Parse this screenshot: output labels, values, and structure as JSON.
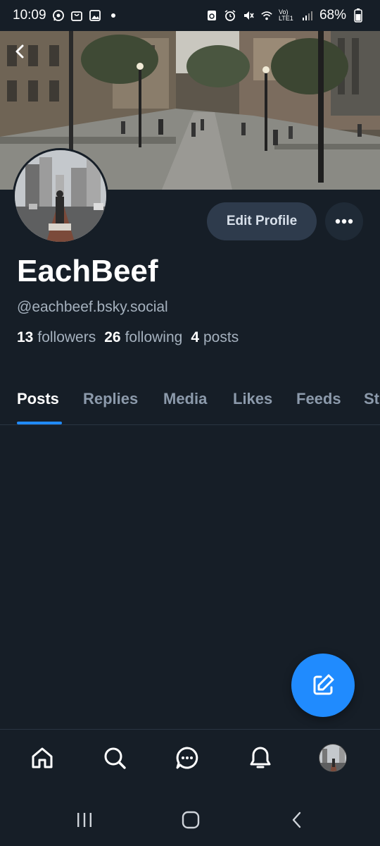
{
  "status_bar": {
    "time": "10:09",
    "battery": "68%",
    "network": "Vo) LTE1",
    "left_icons": [
      "whatsapp-icon",
      "bag-icon",
      "gallery-icon"
    ],
    "right_icons": [
      "recycle-icon",
      "alarm-icon",
      "mute-icon",
      "wifi-icon",
      "signal-icon",
      "battery-icon"
    ]
  },
  "profile": {
    "display_name": "EachBeef",
    "handle": "@eachbeef.bsky.social",
    "followers_count": "13",
    "followers_label": "followers",
    "following_count": "26",
    "following_label": "following",
    "posts_count": "4",
    "posts_label": "posts"
  },
  "actions": {
    "edit_profile_label": "Edit Profile"
  },
  "tabs": [
    {
      "label": "Posts",
      "active": true
    },
    {
      "label": "Replies",
      "active": false
    },
    {
      "label": "Media",
      "active": false
    },
    {
      "label": "Likes",
      "active": false
    },
    {
      "label": "Feeds",
      "active": false
    },
    {
      "label": "St",
      "active": false
    }
  ],
  "bottom_nav": [
    "home-icon",
    "search-icon",
    "chat-icon",
    "bell-icon",
    "profile-avatar"
  ],
  "colors": {
    "background": "#161e27",
    "accent": "#208bfe",
    "button_bg": "#2e3b4c",
    "muted_text": "#a5b1be",
    "tab_inactive": "#8c9aab"
  }
}
